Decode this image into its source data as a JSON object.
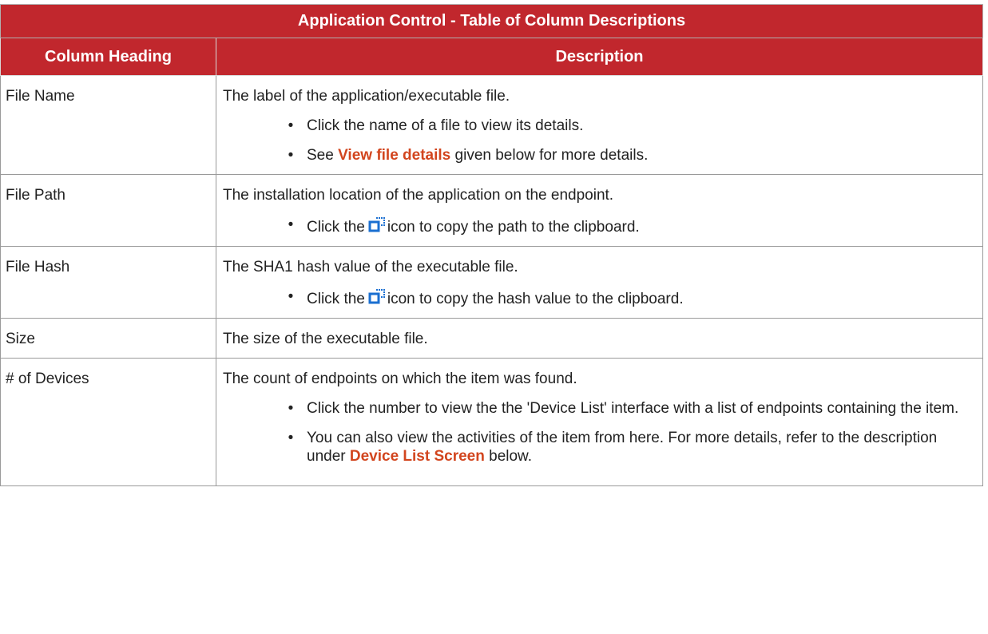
{
  "table": {
    "title": "Application Control - Table of Column Descriptions",
    "headers": [
      "Column Heading",
      "Description"
    ],
    "rows": {
      "file_name": {
        "heading": "File Name",
        "description": "The label of the application/executable file.",
        "bullet1": "Click the name of a file to view its details.",
        "bullet2_prefix": "See ",
        "bullet2_link": "View file details",
        "bullet2_suffix": " given below for more details."
      },
      "file_path": {
        "heading": "File Path",
        "description": "The installation location of the application on the endpoint.",
        "bullet1_prefix": "Click the",
        "bullet1_suffix": "icon to copy the path to the clipboard."
      },
      "file_hash": {
        "heading": "File Hash",
        "description": "The SHA1 hash value of the executable file.",
        "bullet1_prefix": "Click the",
        "bullet1_suffix": "icon to copy the hash value to the clipboard."
      },
      "size": {
        "heading": "Size",
        "description": "The size of the executable file."
      },
      "devices": {
        "heading": "# of Devices",
        "description": "The count of endpoints on which the item was found.",
        "bullet1": "Click the number to view the the 'Device List' interface with a list of endpoints containing the item.",
        "bullet2_prefix": "You can also view the activities of the item from here. For more details, refer to the description under ",
        "bullet2_link": "Device List Screen",
        "bullet2_suffix": " below."
      }
    },
    "bullet_char": "•"
  },
  "colors": {
    "header_bg": "#c1272d",
    "link": "#d2451e",
    "icon": "#1a6fd1"
  },
  "icons": {
    "copy": "copy-to-clipboard-icon"
  }
}
